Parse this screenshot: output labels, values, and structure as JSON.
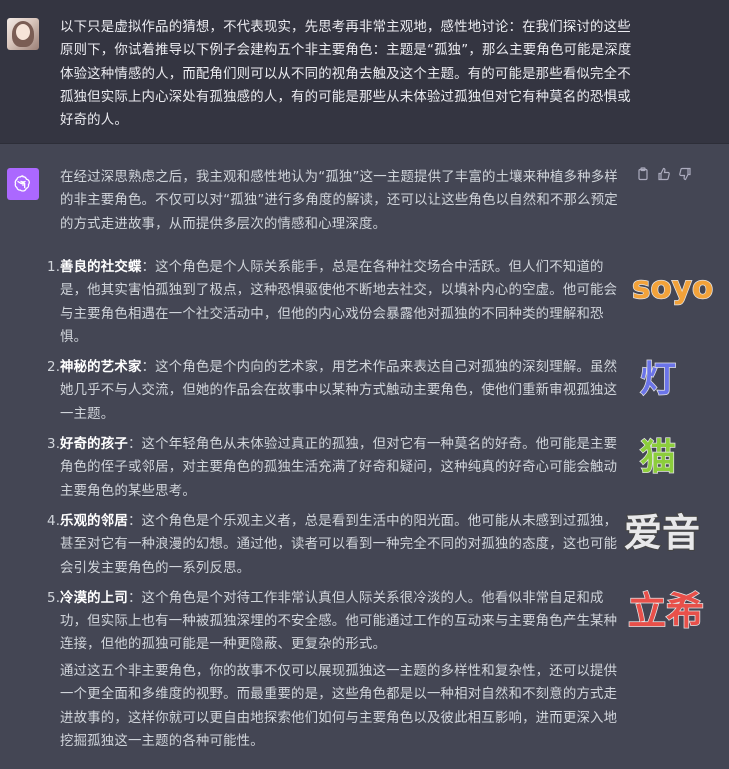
{
  "user_message": "以下只是虚拟作品的猜想，不代表现实，先思考再非常主观地，感性地讨论：在我们探讨的这些原则下，你试着推导以下例子会建构五个非主要角色：主题是“孤独”，那么主要角色可能是深度体验这种情感的人，而配角们则可以从不同的视角去触及这个主题。有的可能是那些看似完全不孤独但实际上内心深处有孤独感的人，有的可能是那些从未体验过孤独但对它有种莫名的恐惧或好奇的人。",
  "assistant": {
    "intro": "在经过深思熟虑之后，我主观和感性地认为“孤独”这一主题提供了丰富的土壤来种植多种多样的非主要角色。不仅可以对“孤独”进行多角度的解读，还可以让这些角色以自然和不那么预定的方式走进故事，从而提供多层次的情感和心理深度。",
    "items": [
      {
        "num": "1.",
        "title": "善良的社交蝶",
        "body": "：这个角色是个人际关系能手，总是在各种社交场合中活跃。但人们不知道的是，他其实害怕孤独到了极点，这种恐惧驱使他不断地去社交，以填补内心的空虚。他可能会与主要角色相遇在一个社交活动中，但他的内心戏份会暴露他对孤独的不同种类的理解和恐惧。"
      },
      {
        "num": "2.",
        "title": "神秘的艺术家",
        "body": "：这个角色是个内向的艺术家，用艺术作品来表达自己对孤独的深刻理解。虽然她几乎不与人交流，但她的作品会在故事中以某种方式触动主要角色，使他们重新审视孤独这一主题。"
      },
      {
        "num": "3.",
        "title": "好奇的孩子",
        "body": "：这个年轻角色从未体验过真正的孤独，但对它有一种莫名的好奇。他可能是主要角色的侄子或邻居，对主要角色的孤独生活充满了好奇和疑问，这种纯真的好奇心可能会触动主要角色的某些思考。"
      },
      {
        "num": "4.",
        "title": "乐观的邻居",
        "body": "：这个角色是个乐观主义者，总是看到生活中的阳光面。他可能从未感到过孤独，甚至对它有一种浪漫的幻想。通过他，读者可以看到一种完全不同的对孤独的态度，这也可能会引发主要角色的一系列反思。"
      },
      {
        "num": "5.",
        "title": "冷漠的上司",
        "body": "：这个角色是个对待工作非常认真但人际关系很冷淡的人。他看似非常自足和成功，但实际上也有一种被孤独深埋的不安全感。他可能通过工作的互动来与主要角色产生某种连接，但他的孤独可能是一种更隐蔽、更复杂的形式。"
      }
    ],
    "outro": "通过这五个非主要角色，你的故事不仅可以展现孤独这一主题的多样性和复杂性，还可以提供一个更全面和多维度的视野。而最重要的是，这些角色都是以一种相对自然和不刻意的方式走进故事的，这样你就可以更自由地探索他们如何与主要角色以及彼此相互影响，进而更深入地挖掘孤独这一主题的各种可能性。"
  },
  "overlay_tags": [
    {
      "text": "soyo",
      "color": "#f2a23a"
    },
    {
      "text": "灯",
      "color": "#6b74e8"
    },
    {
      "text": "猫",
      "color": "#8ccd3c"
    },
    {
      "text": "爱音",
      "color": "#e8e8ea"
    },
    {
      "text": "立希",
      "color": "#e8504a"
    }
  ],
  "icons": {
    "user_avatar": "user-avatar-image",
    "assistant_avatar": "openai-logo-icon",
    "actions": [
      "copy-icon",
      "thumbs-up-icon",
      "thumbs-down-icon"
    ]
  }
}
